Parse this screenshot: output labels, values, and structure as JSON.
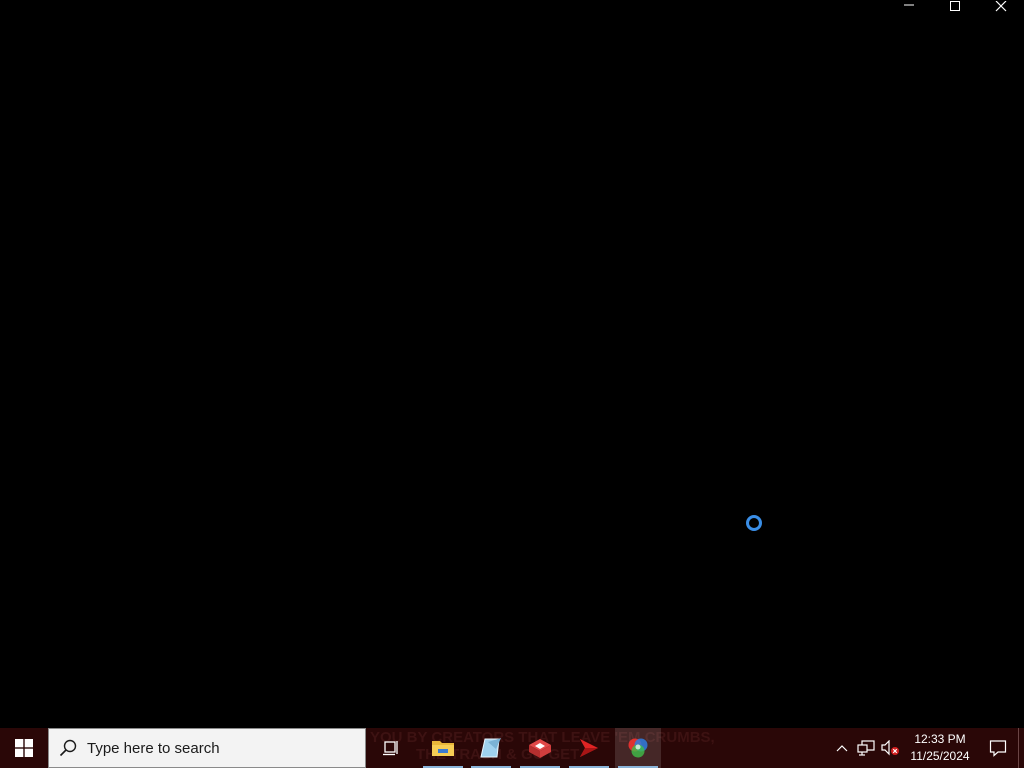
{
  "window": {
    "caption_buttons": [
      "minimize",
      "maximize",
      "close"
    ]
  },
  "content": {
    "loading_indicator": "spinner-icon"
  },
  "taskbar": {
    "start_icon": "windows-logo-icon",
    "search": {
      "placeholder": "Type here to search",
      "icon": "search-icon"
    },
    "wallpaper_text_line1": "YOU BY CREATORS THAT LEAVE 'EM CRUMBS,",
    "wallpaper_text_line2": "THE TRASH & GO GET",
    "pinned_apps": [
      {
        "name": "task-view-icon"
      },
      {
        "name": "file-explorer-icon"
      },
      {
        "name": "notepad-icon"
      },
      {
        "name": "app-red-box-icon"
      },
      {
        "name": "app-red-arrow-icon"
      },
      {
        "name": "color-app-icon",
        "active": true
      }
    ],
    "tray": {
      "chevron_icon": "chevron-up-icon",
      "network_icon": "network-icon",
      "volume_icon": "volume-muted-icon",
      "time": "12:33 PM",
      "date": "11/25/2024",
      "notification_icon": "notification-icon"
    }
  },
  "colors": {
    "taskbar_bg": "#2a0707",
    "desktop_bg": "#000000",
    "accent": "#3a8ee6"
  }
}
